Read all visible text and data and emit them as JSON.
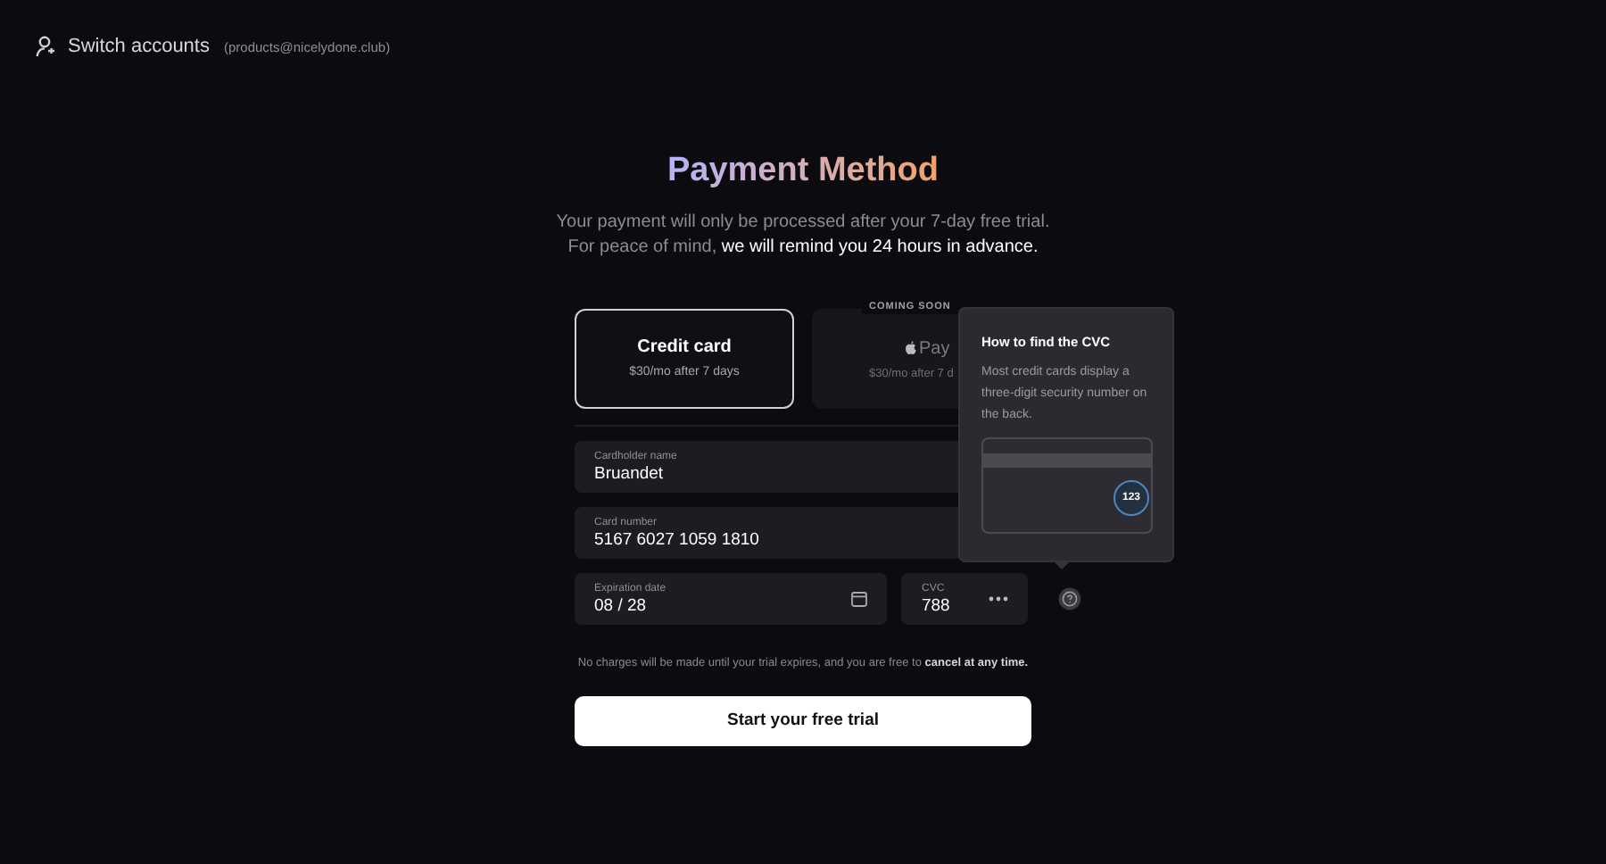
{
  "account": {
    "label": "Switch accounts",
    "email": "(products@nicelydone.club)"
  },
  "title": "Payment Method",
  "subtitle": [
    "Your payment will only be processed after your 7-day free trial.",
    "For peace of mind, **we will remind you 24 hours in advance.**"
  ],
  "methods": [
    {
      "kind": "card",
      "label": "Credit card",
      "price": "$30/mo after 7 days",
      "selected": true,
      "disabled": false
    },
    {
      "kind": "applepay",
      "label": "Pay",
      "price": "$30/mo after 7 d",
      "badge": "COMING SOON",
      "selected": false,
      "disabled": true
    }
  ],
  "fields": [
    {
      "kind": "text",
      "label": "Cardholder name",
      "value": "Bruandet"
    },
    {
      "kind": "text",
      "label": "Card number",
      "value": "5167 6027 1059 1810"
    },
    {
      "kind": "date",
      "label": "Expiration date",
      "value": "08 / 28"
    },
    {
      "kind": "cvc",
      "label": "CVC",
      "value": "788"
    }
  ],
  "tooltip": {
    "title": "How to find the CVC",
    "text": "Most credit cards display a three-digit security number on the back.",
    "sample": "123"
  },
  "note": "No charges will be made until your trial expires, and you are free to **cancel at any time.**",
  "submit": "Start your free trial"
}
